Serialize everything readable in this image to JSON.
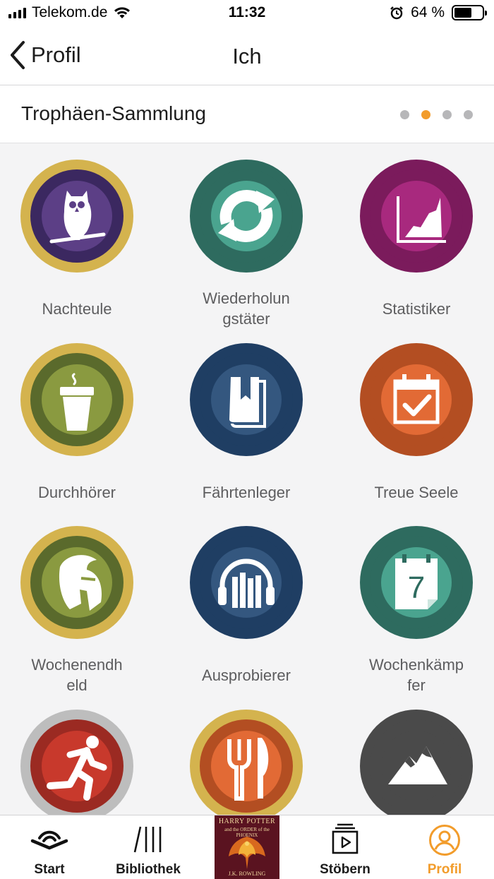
{
  "status_bar": {
    "carrier": "Telekom.de",
    "time": "11:32",
    "battery_percent": "64 %",
    "battery_level": 0.64,
    "icons": [
      "signal-icon",
      "wifi-icon",
      "alarm-icon",
      "battery-icon"
    ]
  },
  "nav": {
    "back_label": "Profil",
    "title": "Ich"
  },
  "section": {
    "title": "Trophäen-Sammlung",
    "page_count": 4,
    "active_page": 2
  },
  "trophies": [
    {
      "label": "Nachteule",
      "icon": "owl-icon",
      "ring": "#d4b34e",
      "inner": "#3b2860",
      "core": "#5c3f86"
    },
    {
      "label": "Wiederholun gstäter",
      "icon": "repeat-icon",
      "ring": "#2e6b5f",
      "inner": "#2e6b5f",
      "core": "#4aa48f"
    },
    {
      "label": "Statistiker",
      "icon": "chart-icon",
      "ring": "#7b1b5c",
      "inner": "#7b1b5c",
      "core": "#a8297e"
    },
    {
      "label": "Durchhörer",
      "icon": "coffee-cup-icon",
      "ring": "#d4b34e",
      "inner": "#5a6a2c",
      "core": "#8a9a40"
    },
    {
      "label": "Fährtenleger",
      "icon": "book-bookmark-icon",
      "ring": "#1f3e63",
      "inner": "#1f3e63",
      "core": "#34577f"
    },
    {
      "label": "Treue Seele",
      "icon": "calendar-check-icon",
      "ring": "#b34e22",
      "inner": "#b34e22",
      "core": "#e26a35"
    },
    {
      "label": "Wochenendh eld",
      "icon": "spartan-helmet-icon",
      "ring": "#d4b34e",
      "inner": "#5a6a2c",
      "core": "#8a9a40"
    },
    {
      "label": "Ausprobierer",
      "icon": "headphones-books-icon",
      "ring": "#1f3e63",
      "inner": "#1f3e63",
      "core": "#34577f"
    },
    {
      "label": "Wochenkämp fer",
      "icon": "calendar-seven-icon",
      "ring": "#2e6b5f",
      "inner": "#2e6b5f",
      "core": "#4aa48f"
    },
    {
      "label": "",
      "icon": "runner-icon",
      "ring": "#bdbdbd",
      "inner": "#9b2a22",
      "core": "#c8392c"
    },
    {
      "label": "",
      "icon": "fork-knife-icon",
      "ring": "#d4b34e",
      "inner": "#b34e22",
      "core": "#e26a35"
    },
    {
      "label": "",
      "icon": "mountain-icon",
      "ring": "#4a4a4a",
      "inner": "#4a4a4a",
      "core": "#4a4a4a"
    }
  ],
  "tabs": [
    {
      "label": "Start",
      "icon": "audible-logo-icon"
    },
    {
      "label": "Bibliothek",
      "icon": "library-icon"
    },
    {
      "label": "",
      "icon": "now-playing-cover"
    },
    {
      "label": "Stöbern",
      "icon": "browse-play-icon"
    },
    {
      "label": "Profil",
      "icon": "profile-icon"
    }
  ],
  "now_playing": {
    "series": "HARRY POTTER",
    "book": "and the ORDER of the PHOENIX",
    "author": "J.K. ROWLING"
  },
  "colors": {
    "accent": "#f29c2b",
    "text": "#1c1c1c",
    "label_gray": "#5d5d5f",
    "background": "#f4f4f5"
  }
}
